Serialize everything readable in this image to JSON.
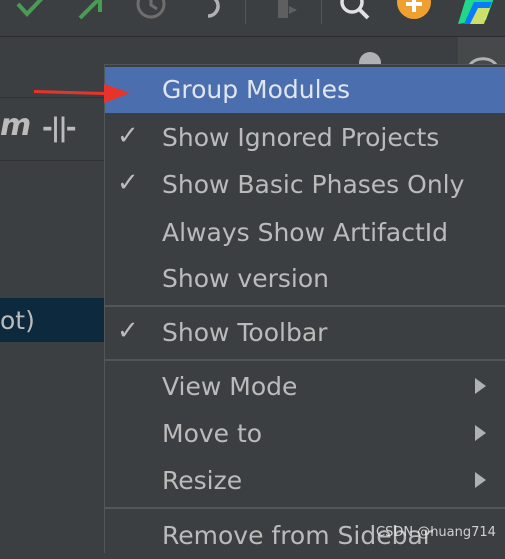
{
  "colors": {
    "background": "#3c3f41",
    "menu_selected": "#4b6eaf",
    "text": "#bbbbbb",
    "arrow_annotation": "#e8332a",
    "check_green": "#499c54",
    "search_orange": "#f0a030"
  },
  "toolbar": {
    "icons": [
      "check-green-icon",
      "arrow-green-icon",
      "history-icon",
      "undo-icon",
      "run-config-icon",
      "search-icon",
      "update-icon",
      "ide-logo-icon"
    ]
  },
  "panel": {
    "maven_label": "m",
    "skip_tests_label": "-||-",
    "tree_row_text": "ot)"
  },
  "menu": {
    "items": [
      {
        "label": "Group Modules",
        "checked": false,
        "submenu": false,
        "selected": true
      },
      {
        "label": "Show Ignored Projects",
        "checked": true,
        "submenu": false
      },
      {
        "label": "Show Basic Phases Only",
        "checked": true,
        "submenu": false
      },
      {
        "label": "Always Show ArtifactId",
        "checked": false,
        "submenu": false
      },
      {
        "label": "Show version",
        "checked": false,
        "submenu": false
      },
      {
        "label": "Show Toolbar",
        "checked": true,
        "submenu": false
      },
      {
        "label": "View Mode",
        "checked": false,
        "submenu": true
      },
      {
        "label": "Move to",
        "checked": false,
        "submenu": true
      },
      {
        "label": "Resize",
        "checked": false,
        "submenu": true
      },
      {
        "label": "Remove from Sidebar",
        "checked": false,
        "submenu": false
      }
    ],
    "check_glyph": "✓"
  },
  "watermark": "CSDN @huang714"
}
